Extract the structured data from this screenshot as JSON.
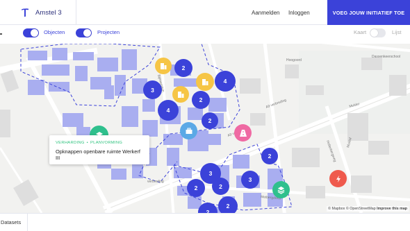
{
  "header": {
    "site_name": "Amstel 3",
    "nav_login": "Aanmelden",
    "nav_signin": "Inloggen",
    "cta_label": "VOEG JOUW INITIATIEF TOE",
    "brand_color": "#3b42d9"
  },
  "filters": {
    "objects_label": "Objecten",
    "objects_on": true,
    "projects_label": "Projecten",
    "projects_on": true
  },
  "view_switch": {
    "map_label": "Kaart",
    "list_label": "Lijst",
    "list_on": false
  },
  "map": {
    "street_labels": [
      "Hoogoord",
      "A9 verbreding",
      "A9 verbreding",
      "Dassenkeerschool",
      "Meibergdreef",
      "Mulder",
      "Muiltof",
      "verbreding",
      "Bijlmerplein",
      "Holterbergweg"
    ],
    "clusters": [
      "2",
      "3",
      "2",
      "4",
      "4",
      "2",
      "2",
      "3",
      "2",
      "2",
      "3",
      "2",
      "2"
    ],
    "category_icons": [
      "building-icon",
      "building-icon",
      "building-icon",
      "layers-icon",
      "briefcase-icon",
      "road-icon",
      "layers-icon",
      "bolt-icon"
    ],
    "popup": {
      "tag1": "VERHARDING",
      "tag2": "PLANVORMING",
      "title": "Opknappen openbare ruimte Werkerf III"
    },
    "attribution_mapbox": "© Mapbox",
    "attribution_osm": "© OpenStreetMap",
    "attribution_improve": "Improve this map"
  },
  "bottom": {
    "datasets_tab": "Datasets"
  }
}
